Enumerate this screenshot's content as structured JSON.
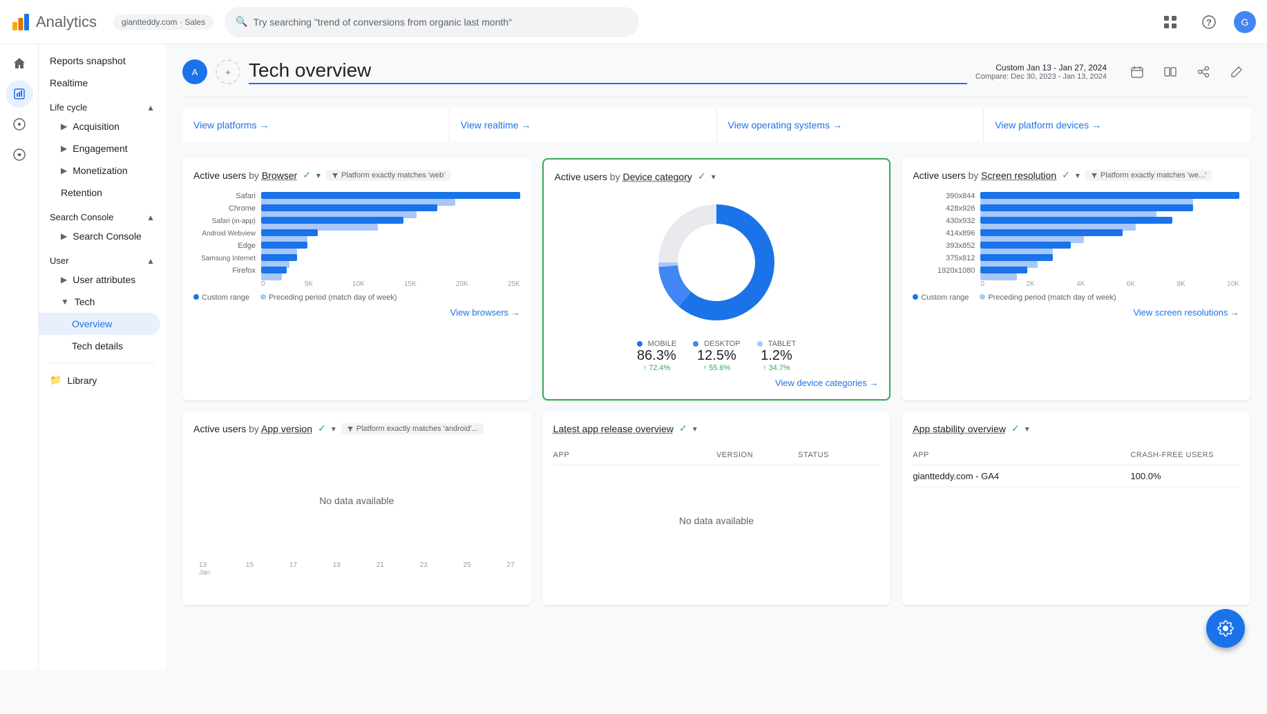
{
  "topbar": {
    "logo_text": "Analytics",
    "account": "giantteddy.com · Sales",
    "search_placeholder": "Try searching \"trend of conversions from organic last month\"",
    "grid_icon": "⊞",
    "help_icon": "?",
    "avatar_letter": "G"
  },
  "sidebar": {
    "reports_snapshot": "Reports snapshot",
    "realtime": "Realtime",
    "lifecycle_label": "Life cycle",
    "acquisition": "Acquisition",
    "engagement": "Engagement",
    "monetization": "Monetization",
    "retention": "Retention",
    "search_console_section": "Search Console",
    "search_console_item": "Search Console",
    "user_section": "User",
    "user_attributes": "User attributes",
    "tech": "Tech",
    "overview": "Overview",
    "tech_details": "Tech details",
    "library": "Library",
    "settings": "⚙"
  },
  "page": {
    "title": "Tech overview",
    "avatar_letter": "A",
    "date_range": "Custom  Jan 13 - Jan 27, 2024",
    "compare": "Compare: Dec 30, 2023 - Jan 13, 2024"
  },
  "nav_links": [
    {
      "label": "View platforms →"
    },
    {
      "label": "View realtime →"
    },
    {
      "label": "View operating systems →"
    },
    {
      "label": "View platform devices →"
    }
  ],
  "browser_chart": {
    "title_metric": "Active users",
    "title_by": " by ",
    "title_dim": "Browser",
    "filter": "Platform exactly matches 'web'",
    "bars": [
      {
        "label": "Safari",
        "main": 100,
        "prev": 75
      },
      {
        "label": "Chrome",
        "main": 68,
        "prev": 60
      },
      {
        "label": "Safari (in-app)",
        "main": 55,
        "prev": 45
      },
      {
        "label": "Android Webview",
        "main": 22,
        "prev": 18
      },
      {
        "label": "Edge",
        "main": 18,
        "prev": 14
      },
      {
        "label": "Samsung Internet",
        "main": 14,
        "prev": 11
      },
      {
        "label": "Firefox",
        "main": 10,
        "prev": 8
      }
    ],
    "x_labels": [
      "0",
      "5K",
      "10K",
      "15K",
      "20K",
      "25K"
    ],
    "legend_current": "Custom range",
    "legend_prev": "Preceding period (match day of week)",
    "link": "View browsers →"
  },
  "device_chart": {
    "title_metric": "Active users",
    "title_by": " by ",
    "title_dim": "Device category",
    "mobile_label": "MOBILE",
    "mobile_value": "86.3%",
    "mobile_change": "↑ 72.4%",
    "desktop_label": "DESKTOP",
    "desktop_value": "12.5%",
    "desktop_change": "↑ 55.6%",
    "tablet_label": "TABLET",
    "tablet_value": "1.2%",
    "tablet_change": "↑ 34.7%",
    "link": "View device categories →",
    "donut": {
      "mobile_pct": 86.3,
      "desktop_pct": 12.5,
      "tablet_pct": 1.2
    }
  },
  "screen_chart": {
    "title_metric": "Active users",
    "title_by": " by ",
    "title_dim": "Screen resolution",
    "filter": "Platform exactly matches 'we...'",
    "bars": [
      {
        "label": "390x844",
        "main": 100,
        "prev": 82
      },
      {
        "label": "428x926",
        "main": 82,
        "prev": 68
      },
      {
        "label": "430x932",
        "main": 74,
        "prev": 60
      },
      {
        "label": "414x896",
        "main": 55,
        "prev": 40
      },
      {
        "label": "393x852",
        "main": 35,
        "prev": 28
      },
      {
        "label": "375x812",
        "main": 28,
        "prev": 22
      },
      {
        "label": "1920x1080",
        "main": 18,
        "prev": 14
      }
    ],
    "x_labels": [
      "0",
      "2K",
      "4K",
      "6K",
      "8K",
      "10K"
    ],
    "legend_current": "Custom range",
    "legend_prev": "Preceding period (match day of week)",
    "link": "View screen resolutions →"
  },
  "app_version_card": {
    "title_metric": "Active users",
    "title_by": " by ",
    "title_dim": "App version",
    "filter": "Platform exactly matches 'android'...",
    "no_data": "No data available"
  },
  "latest_app_card": {
    "title": "Latest app release overview",
    "col_app": "APP",
    "col_version": "VERSION",
    "col_status": "STATUS",
    "no_data": "No data available"
  },
  "app_stability_card": {
    "title": "App stability overview",
    "col_app": "APP",
    "col_crash": "CRASH-FREE USERS",
    "rows": [
      {
        "app": "giantteddy.com - GA4",
        "value": "100.0%"
      }
    ]
  },
  "timeline": {
    "labels": [
      "13 Jan",
      "15",
      "17",
      "19",
      "21",
      "23",
      "25",
      "27"
    ]
  },
  "colors": {
    "blue": "#1a73e8",
    "light_blue": "#a8c7fa",
    "green": "#34a853",
    "gray": "#5f6368"
  }
}
